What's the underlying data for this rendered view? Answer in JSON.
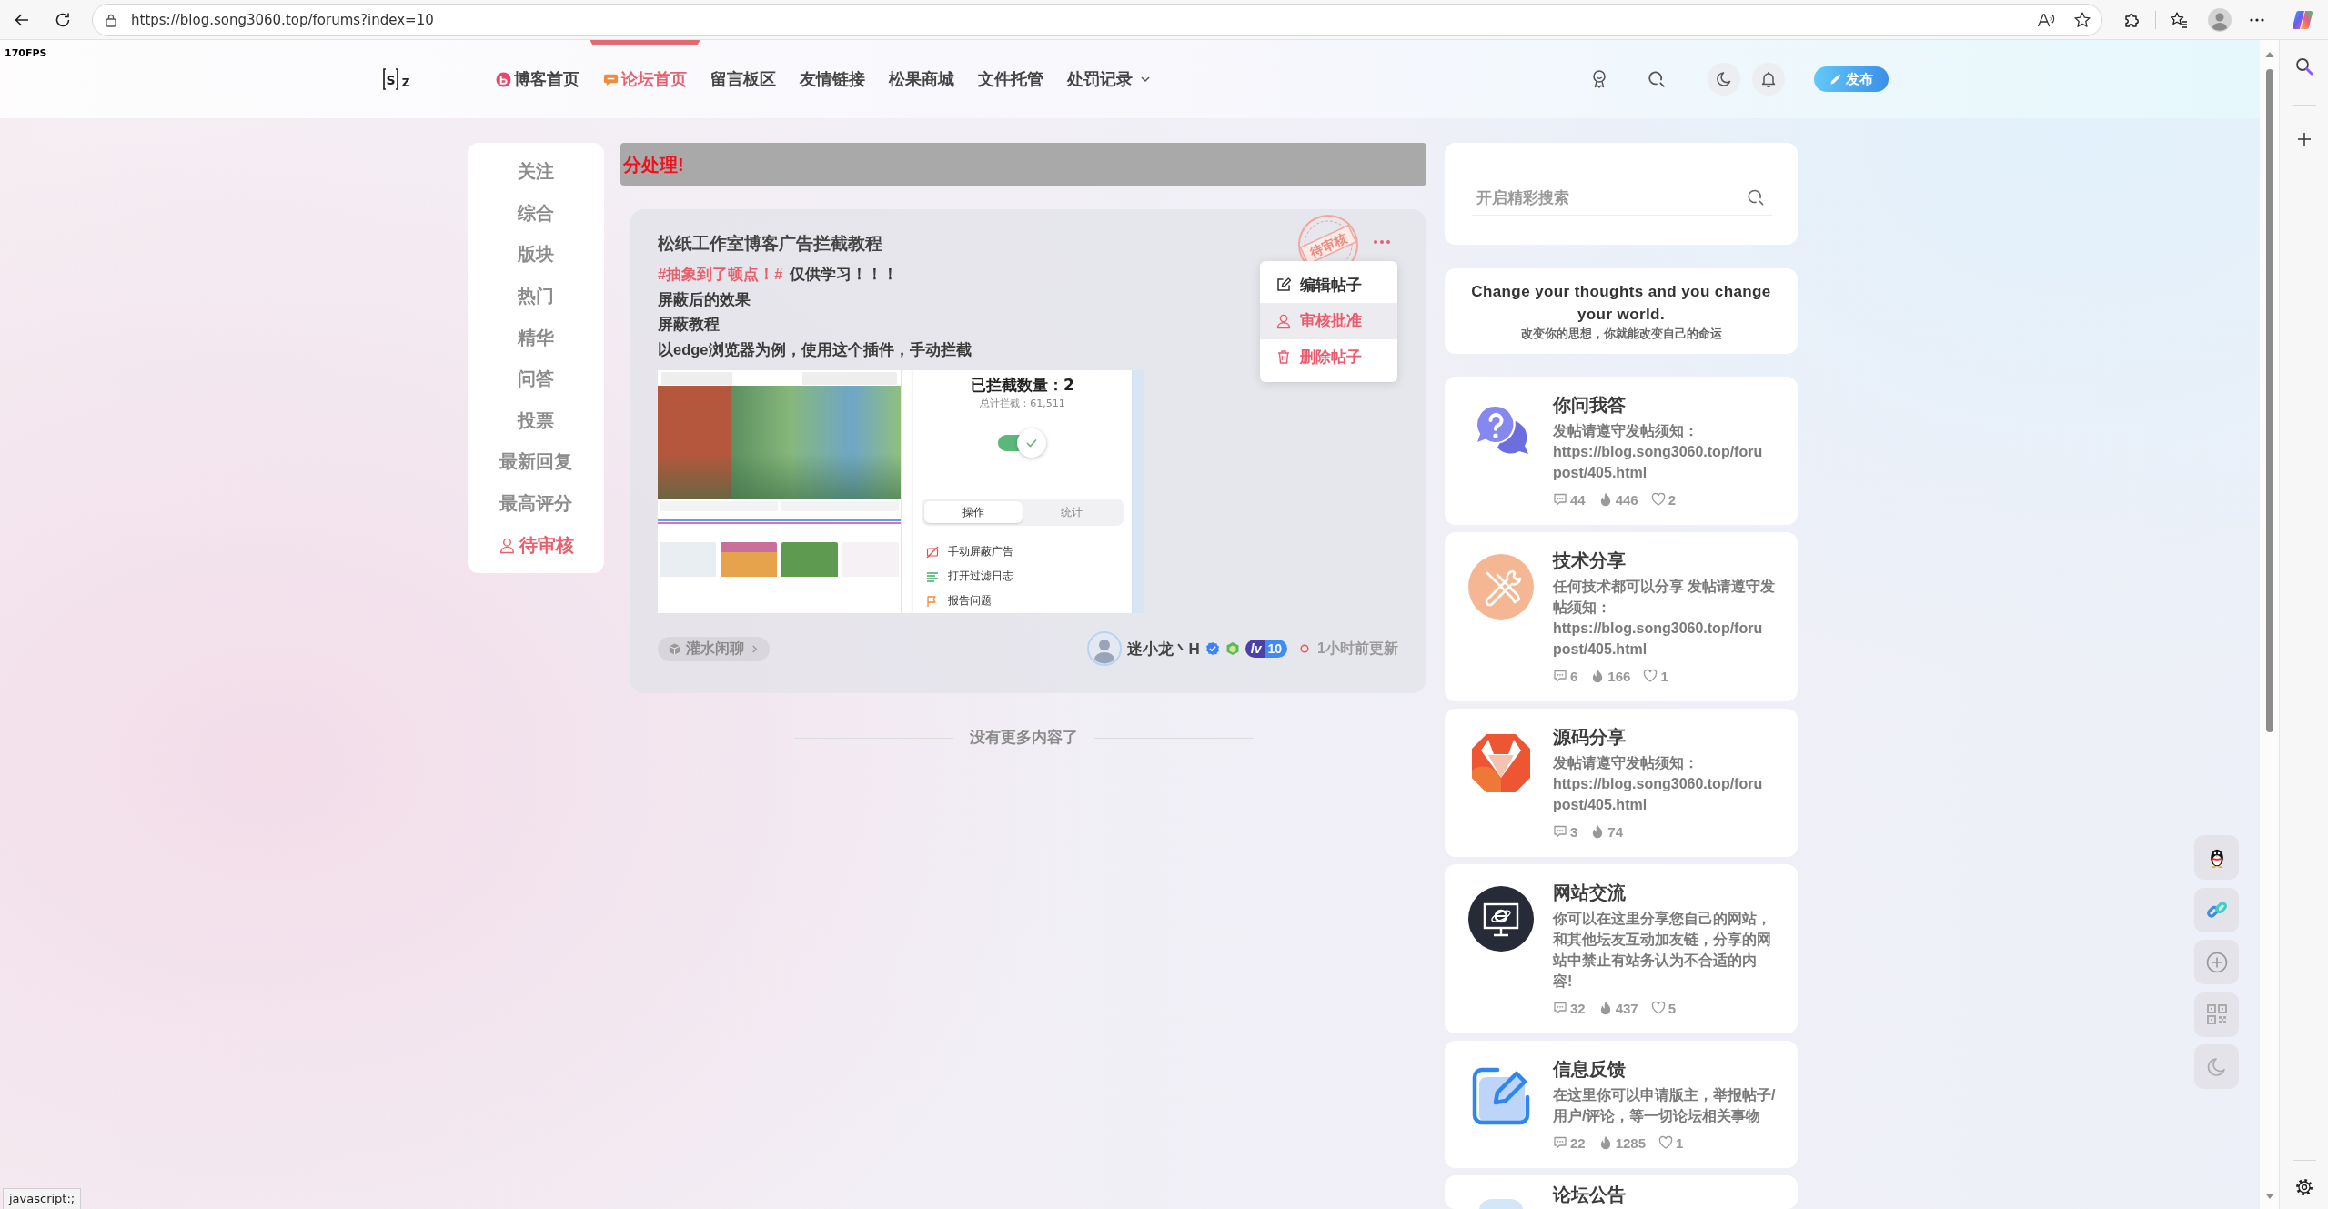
{
  "browser": {
    "url": "https://blog.song3060.top/forums?index=10",
    "status_text": "javascript:;"
  },
  "fps": "170FPS",
  "header": {
    "logo": [
      "S",
      "Z"
    ],
    "nav": [
      {
        "label": "博客首页",
        "selected": false,
        "dropdown": false
      },
      {
        "label": "论坛首页",
        "selected": true,
        "dropdown": false
      },
      {
        "label": "留言板区",
        "selected": false,
        "dropdown": false
      },
      {
        "label": "友情链接",
        "selected": false,
        "dropdown": false
      },
      {
        "label": "松果商城",
        "selected": false,
        "dropdown": false
      },
      {
        "label": "文件托管",
        "selected": false,
        "dropdown": false
      },
      {
        "label": "处罚记录",
        "selected": false,
        "dropdown": true
      }
    ],
    "publish_button": "发布"
  },
  "sidebar": [
    {
      "label": "关注",
      "selected": false
    },
    {
      "label": "综合",
      "selected": false
    },
    {
      "label": "版块",
      "selected": false
    },
    {
      "label": "热门",
      "selected": false
    },
    {
      "label": "精华",
      "selected": false
    },
    {
      "label": "问答",
      "selected": false
    },
    {
      "label": "投票",
      "selected": false
    },
    {
      "label": "最新回复",
      "selected": false
    },
    {
      "label": "最高评分",
      "selected": false
    },
    {
      "label": "待审核",
      "selected": true
    }
  ],
  "notice": "分处理!",
  "post": {
    "title": "松纸工作室博客广告拦截教程",
    "topic": "#抽象到了顿点！#",
    "lines": [
      "仅供学习！！！",
      "屏蔽后的效果",
      "屏蔽教程",
      "以edge浏览器为例，使用这个插件，手动拦截"
    ],
    "stamp": "待审核",
    "menu": [
      {
        "label": "编辑帖子",
        "danger": false,
        "highlighted": false
      },
      {
        "label": "审核批准",
        "danger": true,
        "highlighted": true
      },
      {
        "label": "删除帖子",
        "danger": true,
        "highlighted": false
      }
    ],
    "screenshot": {
      "blocked": "已拦截数量：2",
      "total": "总计拦截：61,511",
      "enabled": true,
      "tabs": [
        {
          "label": "操作",
          "selected": true
        },
        {
          "label": "统计",
          "selected": false
        }
      ],
      "actions": [
        "手动屏蔽广告",
        "打开过滤日志",
        "报告问题"
      ]
    },
    "category": "灌水闲聊",
    "author": {
      "name": "迷小龙丶H",
      "verified": true,
      "rank_prefix": "lv",
      "rank": "10"
    },
    "updated": "1小时前更新"
  },
  "end_text": "没有更多内容了",
  "search": {
    "placeholder": "开启精彩搜索"
  },
  "quote": {
    "text": "Change your thoughts and you change your world.",
    "translation": "改变你的思想，你就能改变自己的命运"
  },
  "boards": [
    {
      "title": "你问我答",
      "description": "发帖请遵守发帖须知：\nhttps://blog.song3060.top/foru\npost/405.html",
      "stats": [
        {
          "kind": "comments",
          "count": "44"
        },
        {
          "kind": "views",
          "count": "446"
        },
        {
          "kind": "likes",
          "count": "2"
        }
      ]
    },
    {
      "title": "技术分享",
      "description": "任何技术都可以分享 发帖请遵守发帖须知：\nhttps://blog.song3060.top/foru\npost/405.html",
      "stats": [
        {
          "kind": "comments",
          "count": "6"
        },
        {
          "kind": "views",
          "count": "166"
        },
        {
          "kind": "likes",
          "count": "1"
        }
      ]
    },
    {
      "title": "源码分享",
      "description": "发帖请遵守发帖须知：\nhttps://blog.song3060.top/foru\npost/405.html",
      "stats": [
        {
          "kind": "comments",
          "count": "3"
        },
        {
          "kind": "views",
          "count": "74"
        }
      ]
    },
    {
      "title": "网站交流",
      "description": "你可以在这里分享您自己的网站，和其他坛友互动加友链，分享的网站中禁止有站务认为不合适的内容!",
      "stats": [
        {
          "kind": "comments",
          "count": "32"
        },
        {
          "kind": "views",
          "count": "437"
        },
        {
          "kind": "likes",
          "count": "5"
        }
      ]
    },
    {
      "title": "信息反馈",
      "description": "在这里你可以申请版主，举报帖子/用户/评论，等一切论坛相关事物",
      "stats": [
        {
          "kind": "comments",
          "count": "22"
        },
        {
          "kind": "views",
          "count": "1285"
        },
        {
          "kind": "likes",
          "count": "1"
        }
      ]
    },
    {
      "title": "论坛公告"
    }
  ]
}
